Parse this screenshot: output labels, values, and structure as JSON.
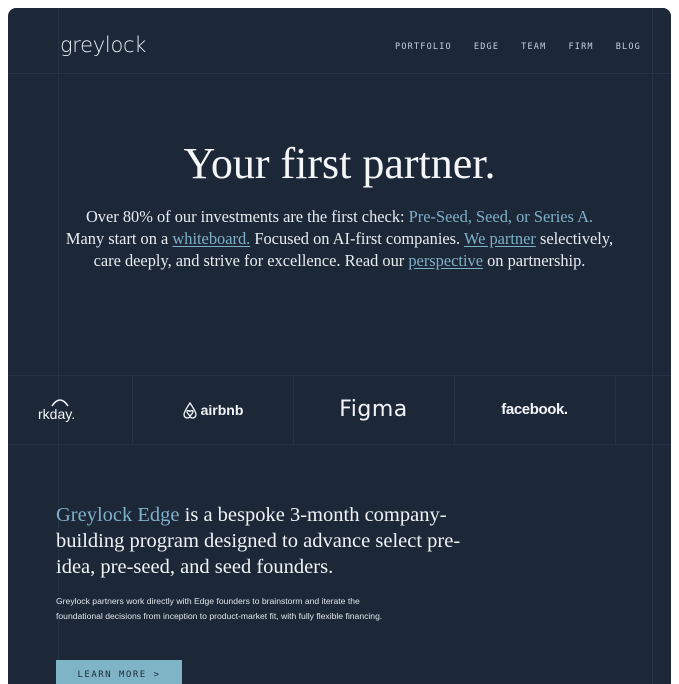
{
  "header": {
    "logo_text": "greylock",
    "nav": [
      "PORTFOLIO",
      "EDGE",
      "TEAM",
      "FIRM",
      "BLOG"
    ]
  },
  "hero": {
    "title": "Your first partner.",
    "line1_pre": "Over 80% of our investments are the first check: ",
    "line1_link": "Pre-Seed, Seed, or Series A.",
    "line2_pre": "Many start on a ",
    "line2_link": "whiteboard.",
    "line2_mid": " Focused on AI-first companies. ",
    "line2_link2": "We partner",
    "line3_pre": " selectively, care deeply, and strive for excellence. Read our ",
    "line3_link": "perspective",
    "line3_post": " on partnership."
  },
  "logos": [
    "rkday.",
    "airbnb",
    "Figma",
    "facebook."
  ],
  "edge": {
    "highlight": "Greylock Edge",
    "title_rest": " is a bespoke 3-month company-building program designed to advance select pre-idea, pre-seed, and seed founders.",
    "body": "Greylock partners work directly with Edge founders to brainstorm and iterate the foundational decisions from inception to product-market fit, with fully flexible financing.",
    "button": "LEARN MORE >"
  },
  "colors": {
    "background": "#1c2838",
    "accent": "#7fb4c6"
  }
}
